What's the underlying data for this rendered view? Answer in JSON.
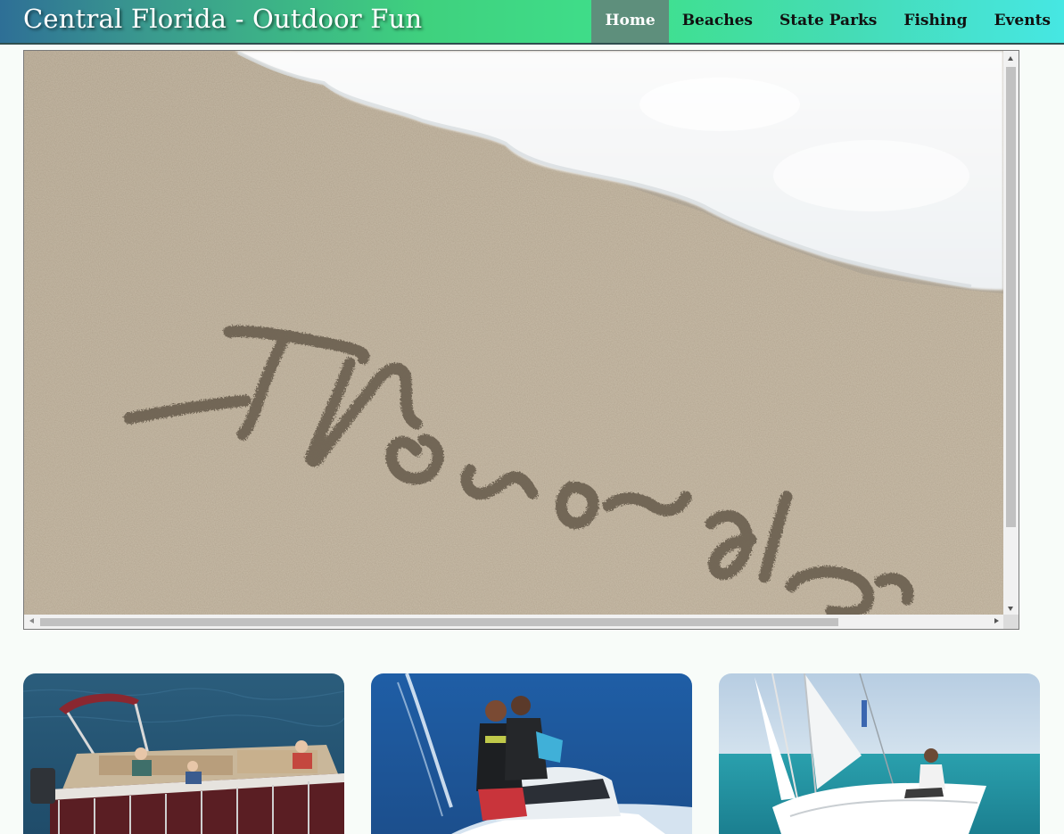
{
  "site": {
    "title": "Central Florida - Outdoor Fun"
  },
  "nav": {
    "items": [
      {
        "label": "Home",
        "active": true
      },
      {
        "label": "Beaches",
        "active": false
      },
      {
        "label": "State Parks",
        "active": false
      },
      {
        "label": "Fishing",
        "active": false
      },
      {
        "label": "Events",
        "active": false
      }
    ]
  },
  "hero": {
    "sand_text": "Florida"
  },
  "cards": [
    {
      "icon": "pontoon-boat-photo"
    },
    {
      "icon": "jet-ski-photo"
    },
    {
      "icon": "sailboat-photo"
    }
  ],
  "colors": {
    "header_start": "#2e6f96",
    "header_end": "#46e7e3",
    "nav_active_bg": "#5e8f7c",
    "page_bg": "#f8fcf9"
  }
}
